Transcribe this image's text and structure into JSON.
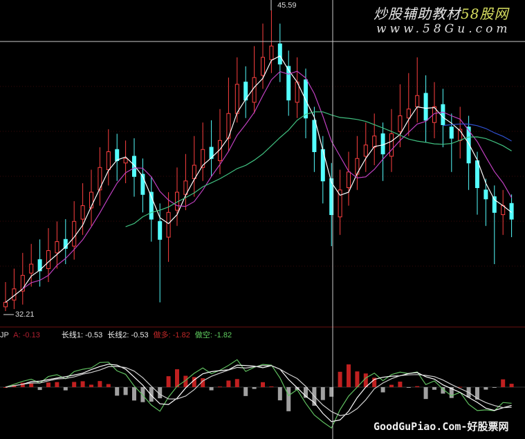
{
  "chart_data": {
    "type": "candlestick",
    "title": "",
    "max_label": "45.59",
    "min_label": "32.21",
    "ylim": [
      32.21,
      45.59
    ],
    "open": [
      32.4,
      32.7,
      33.1,
      33.9,
      34.5,
      34.1,
      34.8,
      35.4,
      35.1,
      36.3,
      36.8,
      37.6,
      38.5,
      39.4,
      38.8,
      39.1,
      38.3,
      37.5,
      36.2,
      35.5,
      36.7,
      37.4,
      38.1,
      38.6,
      39.5,
      38.9,
      39.9,
      41.0,
      42.4,
      41.5,
      42.7,
      43.4,
      44.1,
      43.1,
      41.5,
      42.5,
      40.7,
      39.4,
      38.1,
      36.4,
      37.7,
      38.3,
      39.1,
      39.5,
      40.1,
      39.1,
      40.2,
      40.8,
      41.3,
      41.9,
      40.6,
      41.4,
      40.4,
      39.8,
      40.4,
      38.9,
      37.6,
      37.3,
      36.5,
      37.0
    ],
    "high": [
      33.5,
      34.1,
      34.8,
      35.2,
      35.4,
      35.9,
      36.2,
      36.3,
      37.1,
      37.9,
      38.5,
      39.5,
      40.3,
      40.1,
      39.8,
      39.9,
      39.0,
      38.2,
      37.0,
      37.5,
      38.6,
      39.2,
      40.0,
      40.6,
      40.7,
      41.2,
      42.6,
      43.5,
      43.1,
      44.0,
      45.0,
      45.59,
      45.0,
      43.8,
      43.5,
      43.0,
      41.3,
      40.0,
      38.8,
      38.5,
      39.3,
      40.0,
      40.6,
      41.0,
      40.6,
      41.2,
      42.3,
      42.8,
      43.5,
      42.7,
      42.4,
      42.1,
      41.0,
      41.3,
      40.9,
      39.3,
      38.1,
      37.8,
      37.6,
      37.4
    ],
    "low": [
      32.21,
      32.3,
      32.5,
      33.3,
      33.3,
      33.5,
      34.1,
      34.3,
      34.5,
      35.6,
      36.0,
      36.9,
      37.8,
      38.0,
      37.9,
      37.3,
      36.6,
      35.3,
      32.6,
      34.4,
      36.0,
      36.7,
      37.3,
      38.0,
      38.2,
      38.3,
      39.3,
      40.6,
      40.8,
      41.0,
      42.1,
      42.8,
      42.4,
      40.9,
      40.8,
      39.9,
      38.4,
      37.0,
      35.1,
      35.6,
      36.9,
      37.6,
      38.4,
      38.7,
      38.0,
      38.4,
      39.5,
      40.0,
      40.6,
      39.7,
      39.9,
      39.5,
      38.4,
      39.0,
      37.6,
      36.5,
      36.0,
      34.3,
      35.6,
      35.5
    ],
    "close": [
      32.6,
      33.2,
      33.8,
      34.3,
      34.0,
      34.9,
      35.3,
      35.0,
      36.2,
      36.9,
      37.5,
      38.6,
      39.3,
      38.9,
      39.0,
      38.2,
      37.4,
      36.3,
      35.4,
      36.6,
      37.5,
      38.0,
      38.7,
      39.4,
      39.0,
      39.8,
      41.0,
      42.3,
      41.6,
      42.6,
      43.5,
      44.0,
      43.2,
      41.6,
      42.4,
      40.8,
      39.3,
      38.0,
      36.5,
      37.6,
      38.4,
      39.0,
      39.6,
      40.0,
      39.2,
      40.1,
      40.9,
      41.2,
      41.8,
      40.7,
      41.3,
      40.5,
      39.9,
      40.3,
      38.8,
      37.7,
      37.2,
      36.6,
      36.9,
      36.3
    ],
    "colors": {
      "up": "#ff4040",
      "down": "#54ffff",
      "ma5": "#ffffff",
      "ma10": "#c040c0",
      "ma30": "#40c080",
      "ma60": "#3050d0"
    },
    "indicator": {
      "name": "JP",
      "a_label": "A: -0.13",
      "long1_label": "长线1: -0.53",
      "long2_label": "长线2: -0.53",
      "long_label": "做多: -1.82",
      "short_label": "做空: -1.82"
    }
  },
  "watermarks": {
    "top_cn": "炒股辅助教材",
    "top_brand": "58股网",
    "top_url": "www.58Gu.com",
    "bottom": "GoodGuPiao.Com-好股票网"
  }
}
